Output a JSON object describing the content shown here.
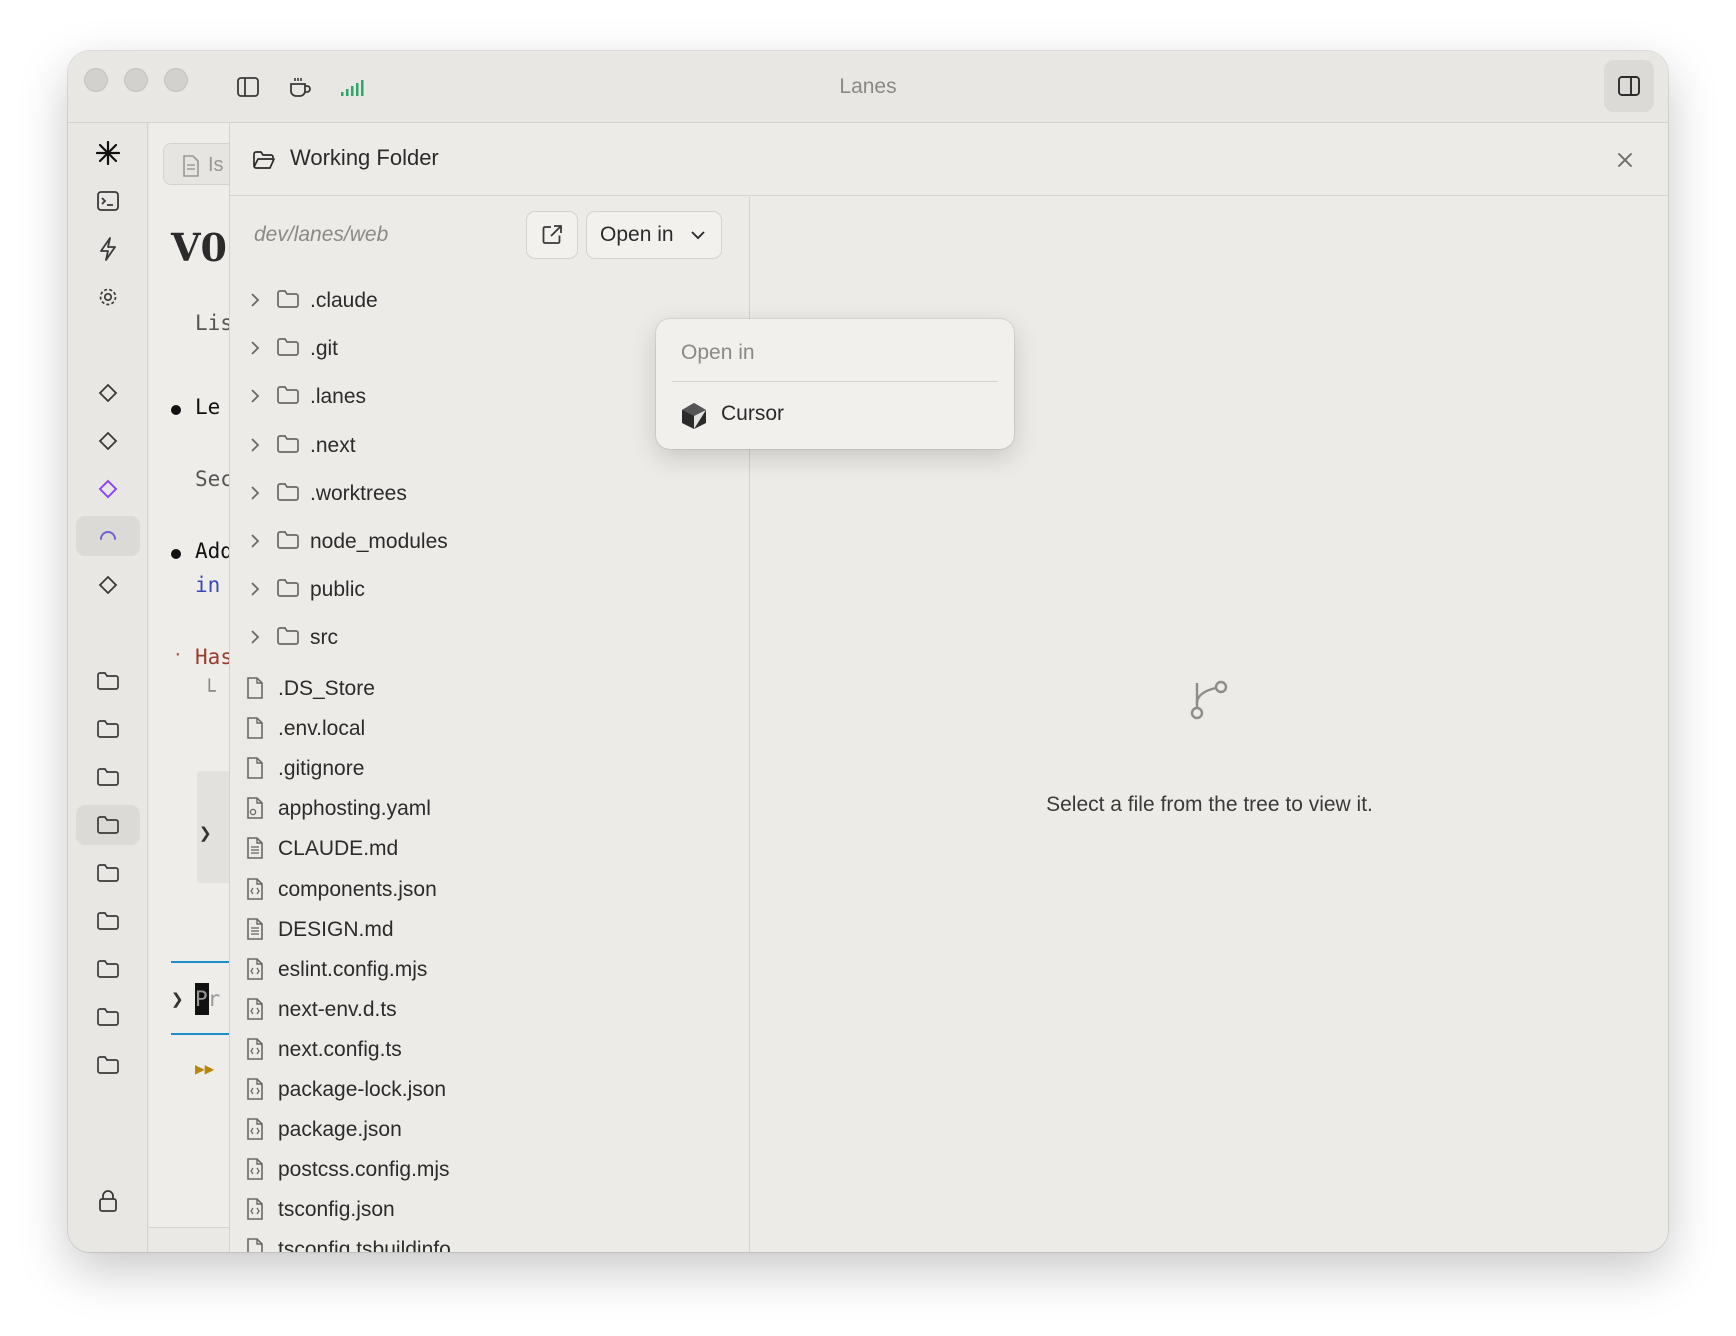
{
  "window": {
    "title": "Lanes"
  },
  "document": {
    "tab_label": "Is",
    "heading": "V0.",
    "lines": [
      "Lis",
      "Le",
      "Sec",
      "Add",
      "in",
      "Has",
      "Pr"
    ]
  },
  "panel": {
    "title": "Working Folder",
    "path": "dev/lanes/web",
    "open_in_label": "Open in",
    "folders": [
      ".claude",
      ".git",
      ".lanes",
      ".next",
      ".worktrees",
      "node_modules",
      "public",
      "src"
    ],
    "files": [
      ".DS_Store",
      ".env.local",
      ".gitignore",
      "apphosting.yaml",
      "CLAUDE.md",
      "components.json",
      "DESIGN.md",
      "eslint.config.mjs",
      "next-env.d.ts",
      "next.config.ts",
      "package-lock.json",
      "package.json",
      "postcss.config.mjs",
      "tsconfig.json",
      "tsconfig.tsbuildinfo"
    ],
    "file_icons": [
      "file-icon",
      "file-icon",
      "file-icon",
      "config-file-icon",
      "text-file-icon",
      "code-file-icon",
      "text-file-icon",
      "code-file-icon",
      "code-file-icon",
      "code-file-icon",
      "code-file-icon",
      "code-file-icon",
      "code-file-icon",
      "code-file-icon",
      "file-icon"
    ],
    "empty_message": "Select a file from the tree to view it."
  },
  "open_in_menu": {
    "header": "Open in",
    "items": [
      {
        "label": "Cursor",
        "icon": "cursor-app-icon"
      }
    ]
  },
  "colors": {
    "accent_purple": "#8a3ffc",
    "accent_blue": "#1d8ec9",
    "signal_green": "#2fa66a"
  }
}
